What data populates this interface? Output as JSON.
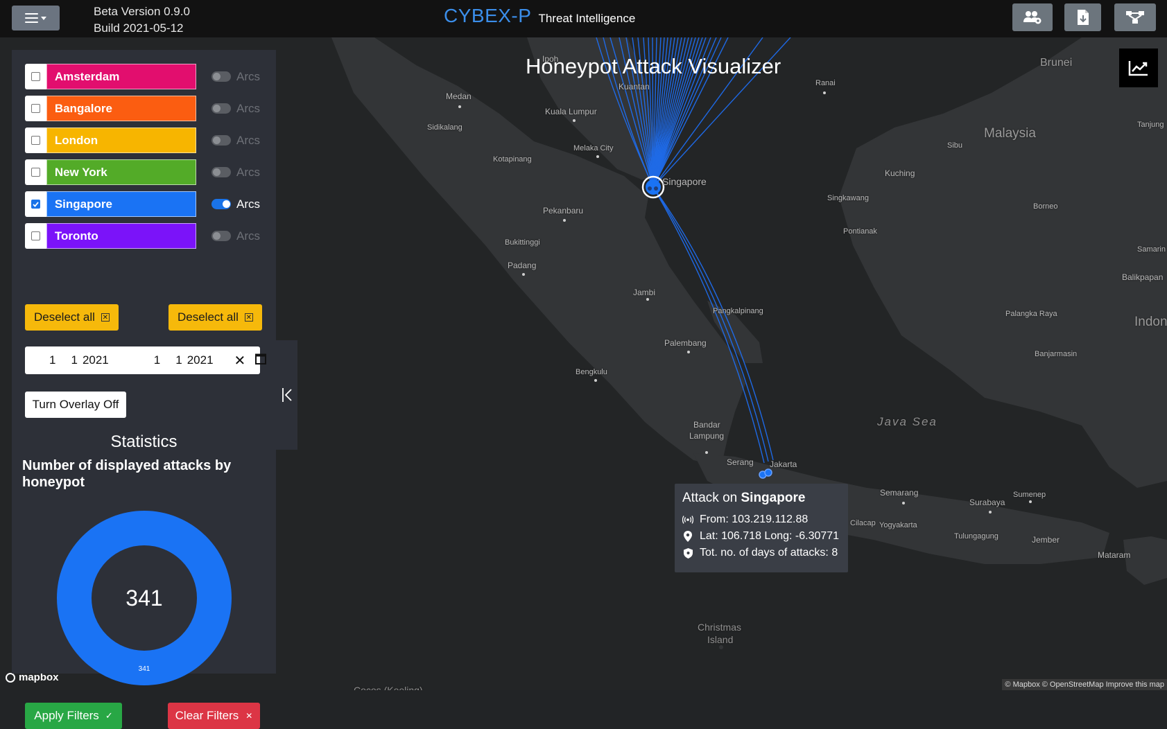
{
  "header": {
    "version_line": "Beta Version 0.9.0",
    "build_line": "Build 2021-05-12",
    "brand": "CYBEX-P",
    "brand_subtitle": "Threat Intelligence",
    "icons": [
      "menu-icon",
      "users-cog-icon",
      "file-export-icon",
      "network-graph-icon"
    ]
  },
  "map": {
    "title": "Honeypot Attack Visualizer",
    "attribution": "© Mapbox © OpenStreetMap Improve this map",
    "logo": "mapbox",
    "places": {
      "ipoh": "Ipoh",
      "brunei": "Brunei",
      "medan": "Medan",
      "kuantan": "Kuantan",
      "ranai": "Ranai",
      "kuala_lumpur": "Kuala Lumpur",
      "sidikalang": "Sidikalang",
      "malaysia": "Malaysia",
      "sibu": "Sibu",
      "tanjung": "Tanjung",
      "melaka": "Melaka City",
      "kotapinang": "Kotapinang",
      "singapore": "Singapore",
      "kuching": "Kuching",
      "singkawang": "Singkawang",
      "pekanbaru": "Pekanbaru",
      "borneo": "Borneo",
      "pontianak": "Pontianak",
      "bukittinggi": "Bukittinggi",
      "samarinda": "Samarin",
      "padang": "Padang",
      "balikpapan": "Balikpapan",
      "jambi": "Jambi",
      "pangkalpinang": "Pangkalpinang",
      "palangka": "Palangka Raya",
      "indonesia": "Indon",
      "palembang": "Palembang",
      "banjarmasin": "Banjarmasin",
      "bengkulu": "Bengkulu",
      "java_sea": "Java Sea",
      "bandar": "Bandar",
      "lampung": "Lampung",
      "serang": "Serang",
      "jakarta": "Jakarta",
      "semarang": "Semarang",
      "sumenep": "Sumenep",
      "surabaya": "Surabaya",
      "cilacap": "Cilacap",
      "yogyakarta": "Yogyakarta",
      "tulungagung": "Tulungagung",
      "jember": "Jember",
      "mataram": "Mataram",
      "christmas": "Christmas",
      "island": "Island",
      "cocos": "Cocos (Keeling)"
    }
  },
  "tooltip": {
    "title_prefix": "Attack on ",
    "title_city": "Singapore",
    "from": "From: 103.219.112.88",
    "latlong": "Lat: 106.718 Long: -6.30771",
    "days": "Tot. no. of days of attacks: 8"
  },
  "sidebar": {
    "cities": [
      {
        "name": "Amsterdam",
        "color": "#e20e6e",
        "checked": false,
        "arcs_on": false
      },
      {
        "name": "Bangalore",
        "color": "#fb5d11",
        "checked": false,
        "arcs_on": false
      },
      {
        "name": "London",
        "color": "#f7b500",
        "checked": false,
        "arcs_on": false
      },
      {
        "name": "New York",
        "color": "#53ab28",
        "checked": false,
        "arcs_on": false
      },
      {
        "name": "Singapore",
        "color": "#1a73f4",
        "checked": true,
        "arcs_on": true
      },
      {
        "name": "Toronto",
        "color": "#7b13f9",
        "checked": false,
        "arcs_on": false
      }
    ],
    "arcs_label": "Arcs",
    "deselect_left": "Deselect all",
    "deselect_right": "Deselect all",
    "date_from": {
      "month": "1",
      "day": "1",
      "year": "2021"
    },
    "date_to": {
      "month": "1",
      "day": "1",
      "year": "2021"
    },
    "overlay_button": "Turn Overlay Off",
    "stats_title": "Statistics",
    "stats_subtitle": "Number of displayed attacks by honeypot",
    "apply_button": "Apply Filters",
    "clear_button": "Clear Filters"
  },
  "chart_data": {
    "type": "pie",
    "donut": true,
    "center_label": "341",
    "slices": [
      {
        "label": "341",
        "value": 341,
        "color": "#1a73f4"
      }
    ]
  }
}
